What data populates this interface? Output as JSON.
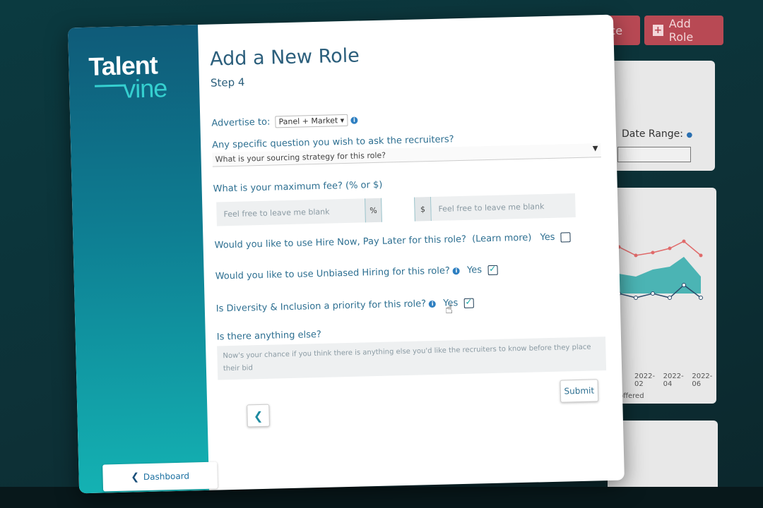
{
  "background": {
    "buttons": [
      {
        "label": "ice"
      },
      {
        "label": "Add Role",
        "icon": "plus-square-icon"
      }
    ],
    "date_range_label": "Date Range:",
    "chart_ticks": [
      "2022-02",
      "2022-04",
      "2022-06"
    ],
    "chart_legend_fragment": "offered",
    "colors": {
      "accent": "#b84954",
      "series_a": "#e06a6a",
      "series_b": "#17a3a3",
      "series_c": "#2a4a6a"
    }
  },
  "sidebar": {
    "logo_top": "Talent",
    "logo_bottom": "vine",
    "dashboard_label": "Dashboard"
  },
  "form": {
    "title": "Add a New Role",
    "subtitle": "Step 4",
    "advertise_label": "Advertise to:",
    "advertise_value": "Panel + Market",
    "question_label": "Any specific question you wish to ask the recruiters?",
    "question_value": "What is your sourcing strategy for this role?",
    "fee_label": "What is your maximum fee? (% or $)",
    "fee_percent_placeholder": "Feel free to leave me blank",
    "fee_percent_addon": "%",
    "fee_dollar_addon": "$",
    "fee_dollar_placeholder": "Feel free to leave me blank",
    "hire_now_label": "Would you like to use Hire Now, Pay Later for this role?",
    "hire_now_link": "(Learn more)",
    "hire_now_yes": "Yes",
    "hire_now_checked": false,
    "unbiased_label": "Would you like to use Unbiased Hiring for this role?",
    "unbiased_yes": "Yes",
    "unbiased_checked": true,
    "diversity_label": "Is Diversity & Inclusion a priority for this role?",
    "diversity_yes": "Yes",
    "diversity_checked": true,
    "anything_else_label": "Is there anything else?",
    "anything_else_placeholder": "Now's your chance if you think there is anything else you'd like the recruiters to know before they place their bid",
    "submit_label": "Submit",
    "back_icon": "chevron-left-icon"
  }
}
